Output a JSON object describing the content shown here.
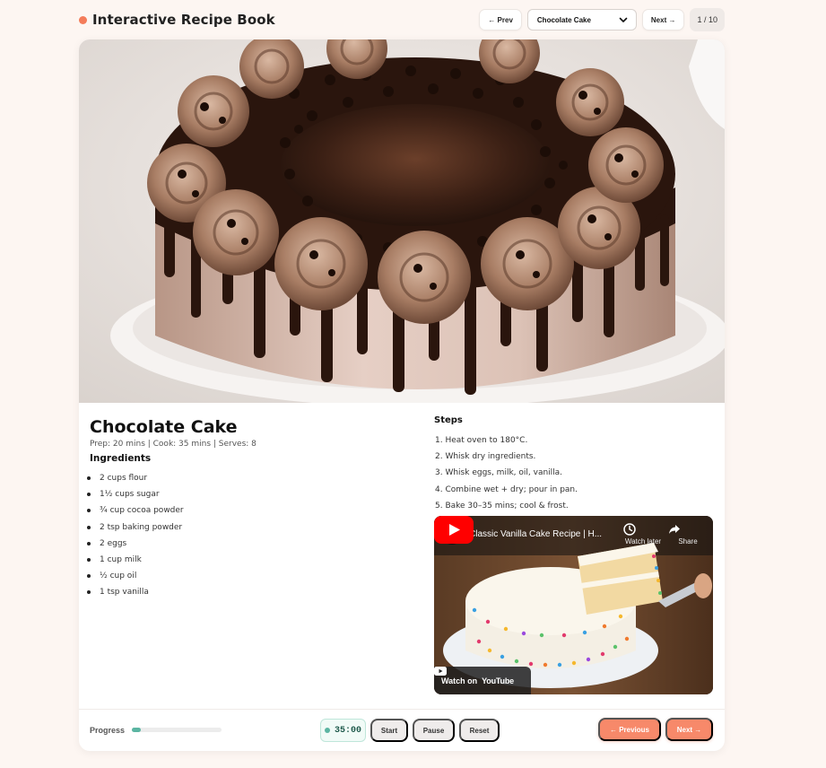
{
  "app": {
    "title": "Interactive Recipe Book",
    "accent_color": "#f47c5a"
  },
  "header_nav": {
    "prev_label": "← Prev",
    "selected_recipe": "Chocolate Cake",
    "next_label": "Next →",
    "counter": "1 / 10"
  },
  "hero_image": {
    "alt": "Chocolate drip cake with piped frosting swirls and chocolate chips"
  },
  "recipe": {
    "title": "Chocolate Cake",
    "meta": "Prep: 20 mins | Cook: 35 mins | Serves: 8",
    "ingredients_heading": "Ingredients",
    "ingredients": [
      "2 cups flour",
      "1½ cups sugar",
      "¾ cup cocoa powder",
      "2 tsp baking powder",
      "2 eggs",
      "1 cup milk",
      "½ cup oil",
      "1 tsp vanilla"
    ],
    "steps_heading": "Steps",
    "steps": [
      "1. Heat oven to 180°C.",
      "2. Whisk dry ingredients.",
      "3. Whisk eggs, milk, oil, vanilla.",
      "4. Combine wet + dry; pour in pan.",
      "5. Bake 30–35 mins; cool & frost."
    ]
  },
  "video": {
    "title": "Classic Vanilla Cake Recipe | H...",
    "watch_later": "Watch later",
    "share": "Share",
    "watch_on": "Watch on",
    "platform": "YouTube"
  },
  "footer": {
    "progress_label": "Progress",
    "progress_fraction": 0.1,
    "timer": "35:00",
    "start_label": "Start",
    "pause_label": "Pause",
    "reset_label": "Reset",
    "previous_label": "← Previous",
    "next_label": "Next →",
    "primary_color": "#f7896a",
    "timer_color": "#5bb5a2"
  }
}
